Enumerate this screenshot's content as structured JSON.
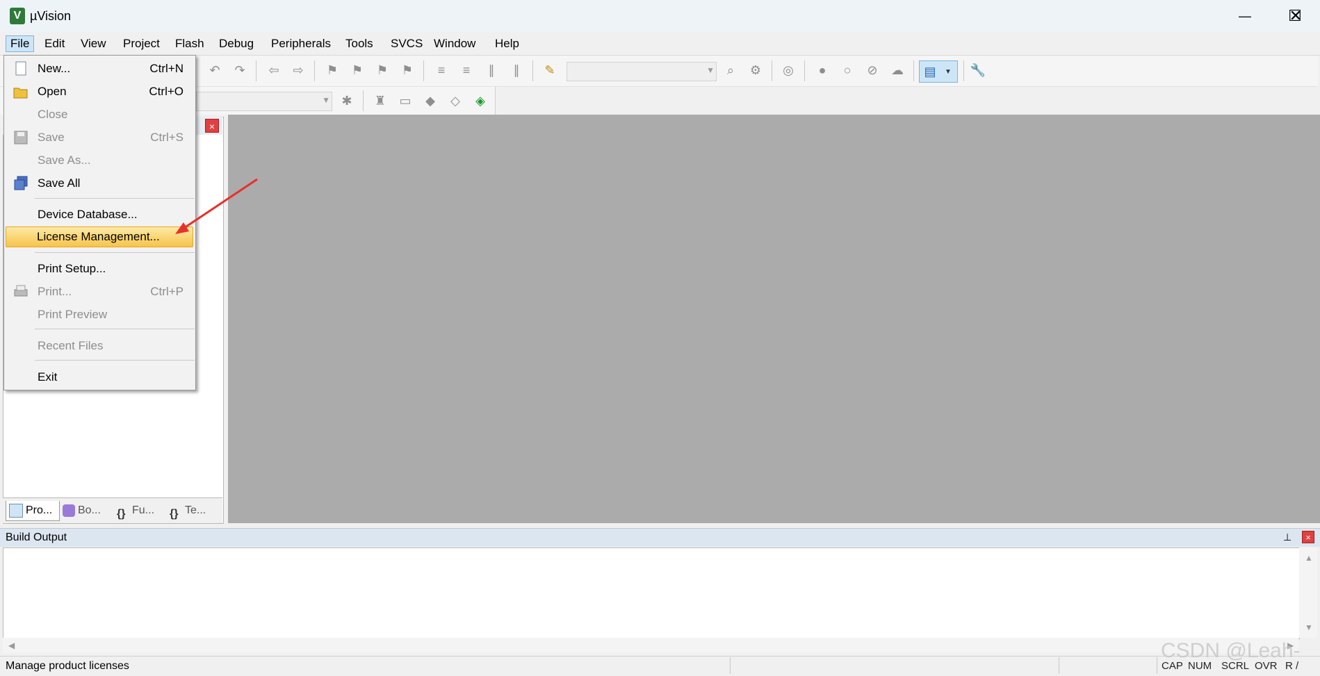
{
  "window": {
    "title": "µVision",
    "app_icon_glyph": "V",
    "controls": {
      "minimize": "—",
      "maximize": "☐",
      "close": "✕"
    }
  },
  "menubar": [
    "File",
    "Edit",
    "View",
    "Project",
    "Flash",
    "Debug",
    "Peripherals",
    "Tools",
    "SVCS",
    "Window",
    "Help"
  ],
  "file_menu": {
    "items": [
      {
        "label": "New...",
        "shortcut": "Ctrl+N",
        "enabled": true,
        "icon": "new-file-icon"
      },
      {
        "label": "Open",
        "shortcut": "Ctrl+O",
        "enabled": true,
        "icon": "open-folder-icon"
      },
      {
        "label": "Close",
        "shortcut": "",
        "enabled": false,
        "icon": ""
      },
      {
        "label": "Save",
        "shortcut": "Ctrl+S",
        "enabled": false,
        "icon": "save-icon"
      },
      {
        "label": "Save As...",
        "shortcut": "",
        "enabled": false,
        "icon": ""
      },
      {
        "label": "Save All",
        "shortcut": "",
        "enabled": true,
        "icon": "save-all-icon"
      },
      {
        "label": "Device Database...",
        "shortcut": "",
        "enabled": true,
        "icon": ""
      },
      {
        "label": "License Management...",
        "shortcut": "",
        "enabled": true,
        "icon": "",
        "highlighted": true
      },
      {
        "label": "Print Setup...",
        "shortcut": "",
        "enabled": true,
        "icon": ""
      },
      {
        "label": "Print...",
        "shortcut": "Ctrl+P",
        "enabled": false,
        "icon": "print-icon"
      },
      {
        "label": "Print Preview",
        "shortcut": "",
        "enabled": false,
        "icon": ""
      },
      {
        "label": "Recent Files",
        "shortcut": "",
        "enabled": false,
        "icon": ""
      },
      {
        "label": "Exit",
        "shortcut": "",
        "enabled": true,
        "icon": ""
      }
    ]
  },
  "project_pane": {
    "close_glyph": "×",
    "tabs": [
      {
        "label": "Pro...",
        "icon": "project-icon",
        "active": true
      },
      {
        "label": "Bo...",
        "icon": "books-icon",
        "active": false
      },
      {
        "label": "Fu...",
        "icon": "functions-icon",
        "active": false
      },
      {
        "label": "Te...",
        "icon": "templates-icon",
        "active": false
      }
    ]
  },
  "build_output": {
    "title": "Build Output",
    "pin_glyph": "⊥",
    "close_glyph": "×"
  },
  "status": {
    "text": "Manage product licenses",
    "indicators": [
      "CAP",
      "NUM",
      "SCRL",
      "OVR",
      "R /"
    ]
  },
  "watermark": "CSDN @Leah-",
  "colors": {
    "editor_bg": "#ababab",
    "highlight": "#f7c44a",
    "arrow": "#e8302a",
    "close_red": "#e04040"
  }
}
